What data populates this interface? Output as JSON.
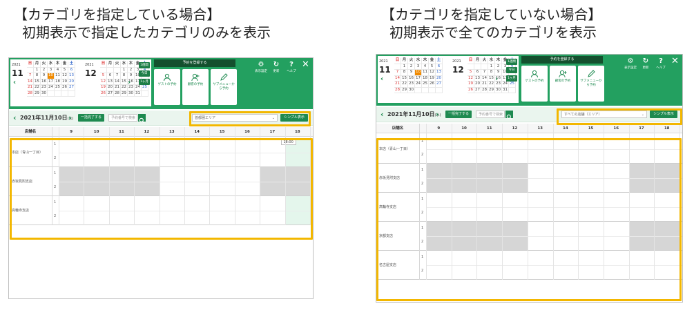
{
  "captions": {
    "left": {
      "line1": "【カテゴリを指定している場合】",
      "line2": "初期表示で指定したカテゴリのみを表示"
    },
    "right": {
      "line1": "【カテゴリを指定していない場合】",
      "line2": "初期表示で全てのカテゴリを表示"
    }
  },
  "calendar": {
    "weekdays": [
      "日",
      "月",
      "火",
      "水",
      "木",
      "金",
      "土"
    ],
    "nov": {
      "year": "2021",
      "month": "11",
      "days": [
        "",
        "1",
        "2",
        "3",
        "4",
        "5",
        "6",
        "7",
        "8",
        "9",
        "10",
        "11",
        "12",
        "13",
        "14",
        "15",
        "16",
        "17",
        "18",
        "19",
        "20",
        "21",
        "22",
        "23",
        "24",
        "25",
        "26",
        "27",
        "28",
        "29",
        "30",
        "",
        "",
        "",
        ""
      ],
      "today": "10"
    },
    "dec": {
      "year": "2021",
      "month": "12",
      "days": [
        "",
        "",
        "",
        "1",
        "2",
        "3",
        "4",
        "5",
        "6",
        "7",
        "8",
        "9",
        "10",
        "11",
        "12",
        "13",
        "14",
        "15",
        "16",
        "17",
        "18",
        "19",
        "20",
        "21",
        "22",
        "23",
        "24",
        "25",
        "26",
        "27",
        "28",
        "29",
        "30",
        "31",
        ""
      ]
    },
    "side_buttons": [
      "1週間",
      "今日",
      "1ヶ月"
    ]
  },
  "register": {
    "title": "予約を登録する",
    "cards": [
      "ゲストの予約",
      "顧客の予約",
      "サブメニューから予約"
    ]
  },
  "top_icons": [
    {
      "glyph": "⚙",
      "label": "表示設定"
    },
    {
      "glyph": "↻",
      "label": "更新"
    },
    {
      "glyph": "?",
      "label": "ヘルプ"
    }
  ],
  "close": "✕",
  "toolbar": {
    "date": "2021年11月10日",
    "weekday": "(水)",
    "bulk_button": "一括完了する",
    "search_placeholder": "予約番号で検索",
    "left_select": "首都圏エリア",
    "right_select": "すべての店舗（エリア）",
    "simple_button": "シンプル表示"
  },
  "grid": {
    "store_header": "店舗名",
    "hours": [
      "9",
      "10",
      "11",
      "12",
      "13",
      "14",
      "15",
      "16",
      "17",
      "18"
    ],
    "lane_labels": [
      "1",
      "2"
    ],
    "tooltip": "18:00",
    "left_stores": [
      "本店（青山一丁目）",
      "赤坂見附支店",
      "高輪寺支店"
    ],
    "right_stores": [
      "本店（青山一丁目）",
      "赤坂見附支店",
      "高輪寺支店",
      "京都支店",
      "名古屋支店"
    ]
  },
  "colors": {
    "brand": "#23a060",
    "highlight": "#f3b700"
  }
}
